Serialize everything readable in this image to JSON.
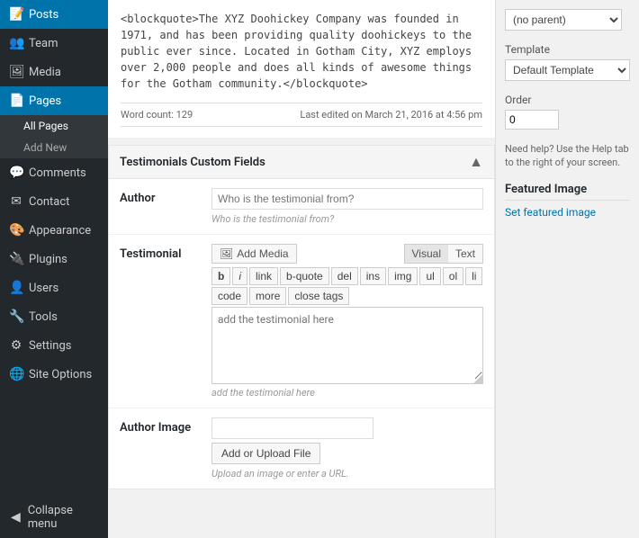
{
  "sidebar": {
    "items": [
      {
        "id": "posts",
        "label": "Posts",
        "icon": "📝",
        "active": false
      },
      {
        "id": "team",
        "label": "Team",
        "icon": "👥",
        "active": false
      },
      {
        "id": "media",
        "label": "Media",
        "icon": "🖼",
        "active": false
      },
      {
        "id": "pages",
        "label": "Pages",
        "icon": "📄",
        "active": true
      },
      {
        "id": "comments",
        "label": "Comments",
        "icon": "💬",
        "active": false
      },
      {
        "id": "contact",
        "label": "Contact",
        "icon": "✉",
        "active": false
      },
      {
        "id": "appearance",
        "label": "Appearance",
        "icon": "🎨",
        "active": false
      },
      {
        "id": "plugins",
        "label": "Plugins",
        "icon": "🔌",
        "active": false
      },
      {
        "id": "users",
        "label": "Users",
        "icon": "👤",
        "active": false
      },
      {
        "id": "tools",
        "label": "Tools",
        "icon": "🔧",
        "active": false
      },
      {
        "id": "settings",
        "label": "Settings",
        "icon": "⚙",
        "active": false
      },
      {
        "id": "site-options",
        "label": "Site Options",
        "icon": "🌐",
        "active": false
      },
      {
        "id": "collapse",
        "label": "Collapse menu",
        "icon": "◀",
        "active": false
      }
    ],
    "sub_items": [
      {
        "label": "All Pages",
        "active": true
      },
      {
        "label": "Add New",
        "active": false
      }
    ]
  },
  "content": {
    "blockquote": "<blockquote>The XYZ Doohickey Company was founded in 1971, and has been providing quality doohickeys to the public ever since. Located in Gotham City, XYZ employs over 2,000 people and does all kinds of awesome things for the Gotham community.</blockquote>",
    "word_count_label": "Word count: 129",
    "last_edited": "Last edited on March 21, 2016 at 4:56 pm"
  },
  "custom_fields": {
    "title": "Testimonials Custom Fields",
    "toggle_icon": "▲",
    "author_field": {
      "label": "Author",
      "placeholder": "Who is the testimonial from?",
      "value": ""
    },
    "testimonial_field": {
      "label": "Testimonial",
      "add_media_label": "Add Media",
      "visual_tab": "Visual",
      "text_tab": "Text",
      "format_buttons": [
        "b",
        "i",
        "link",
        "b-quote",
        "del",
        "ins",
        "img",
        "ul",
        "ol",
        "li"
      ],
      "format_buttons2": [
        "code",
        "more",
        "close tags"
      ],
      "placeholder": "add the testimonial here",
      "value": ""
    },
    "author_image_field": {
      "label": "Author Image",
      "input_value": "",
      "button_label": "Add or Upload File",
      "upload_hint": "Upload an image or enter a URL."
    }
  },
  "right_sidebar": {
    "parent_label": "(no parent)",
    "template_label": "Template",
    "template_value": "Default Template",
    "order_label": "Order",
    "order_value": "0",
    "help_text": "Need help? Use the Help tab to the right of your screen.",
    "featured_image": {
      "title": "Featured Image",
      "link_label": "Set featured image"
    }
  }
}
